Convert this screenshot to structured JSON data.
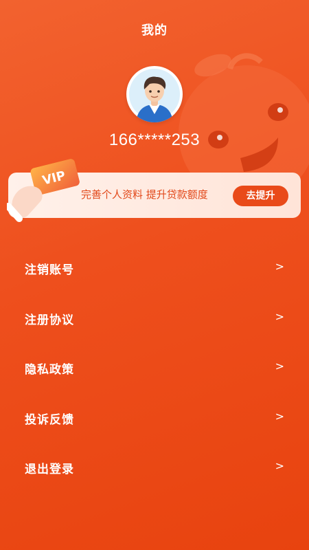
{
  "header": {
    "title": "我的"
  },
  "profile": {
    "phone": "166*****253"
  },
  "vip_banner": {
    "badge_text": "VIP",
    "text": "完善个人资料  提升贷款额度",
    "button_label": "去提升"
  },
  "menu": {
    "items": [
      {
        "label": "注销账号",
        "chevron": ">"
      },
      {
        "label": "注册协议",
        "chevron": ">"
      },
      {
        "label": "隐私政策",
        "chevron": ">"
      },
      {
        "label": "投诉反馈",
        "chevron": ">"
      },
      {
        "label": "退出登录",
        "chevron": ">"
      }
    ]
  },
  "colors": {
    "background": "#ee4f1d",
    "accent": "#e94a19",
    "banner_bg": "#ffede4",
    "text_on_bg": "#ffffff"
  },
  "icons": {
    "avatar": "cartoon-man-avatar",
    "mascot": "orange-mascot-icon",
    "vip": "vip-card-icon"
  }
}
